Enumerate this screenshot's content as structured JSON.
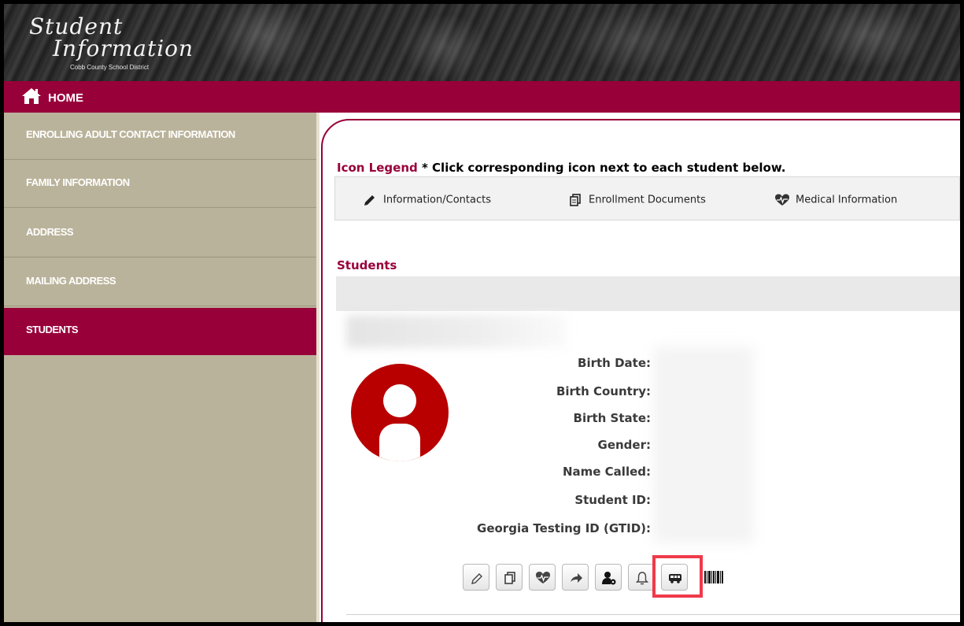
{
  "banner": {
    "title_line1": "Student",
    "title_line2": "Information",
    "subtitle": "Cobb County School District"
  },
  "homebar": {
    "icon": "home-icon",
    "label": "HOME"
  },
  "sidebar": {
    "items": [
      {
        "label": "ENROLLING ADULT CONTACT INFORMATION",
        "active": false
      },
      {
        "label": "FAMILY INFORMATION",
        "active": false
      },
      {
        "label": "ADDRESS",
        "active": false
      },
      {
        "label": "MAILING ADDRESS",
        "active": false
      },
      {
        "label": "STUDENTS",
        "active": true
      }
    ]
  },
  "legend": {
    "title": "Icon Legend",
    "instruction": "* Click corresponding icon next to each student below.",
    "items": [
      {
        "icon": "pencil-icon",
        "label": "Information/Contacts"
      },
      {
        "icon": "documents-icon",
        "label": "Enrollment Documents"
      },
      {
        "icon": "heartbeat-icon",
        "label": "Medical Information"
      }
    ]
  },
  "students": {
    "title": "Students",
    "fields": [
      {
        "label": "Birth Date:"
      },
      {
        "label": "Birth Country:"
      },
      {
        "label": "Birth State:"
      },
      {
        "label": "Gender:"
      },
      {
        "label": "Name Called:"
      },
      {
        "label": "Student ID:"
      },
      {
        "label": "Georgia Testing ID (GTID):"
      }
    ],
    "toolbar_icons": [
      "pencil-icon",
      "documents-icon",
      "heartbeat-icon",
      "arrow-right-icon",
      "user-settings-icon",
      "bell-icon",
      "bus-icon",
      "barcode-icon"
    ],
    "highlighted_icon": "bus-icon"
  },
  "colors": {
    "brand": "#98003a",
    "sidebar": "#bab39b",
    "highlight": "#f03a4a"
  }
}
